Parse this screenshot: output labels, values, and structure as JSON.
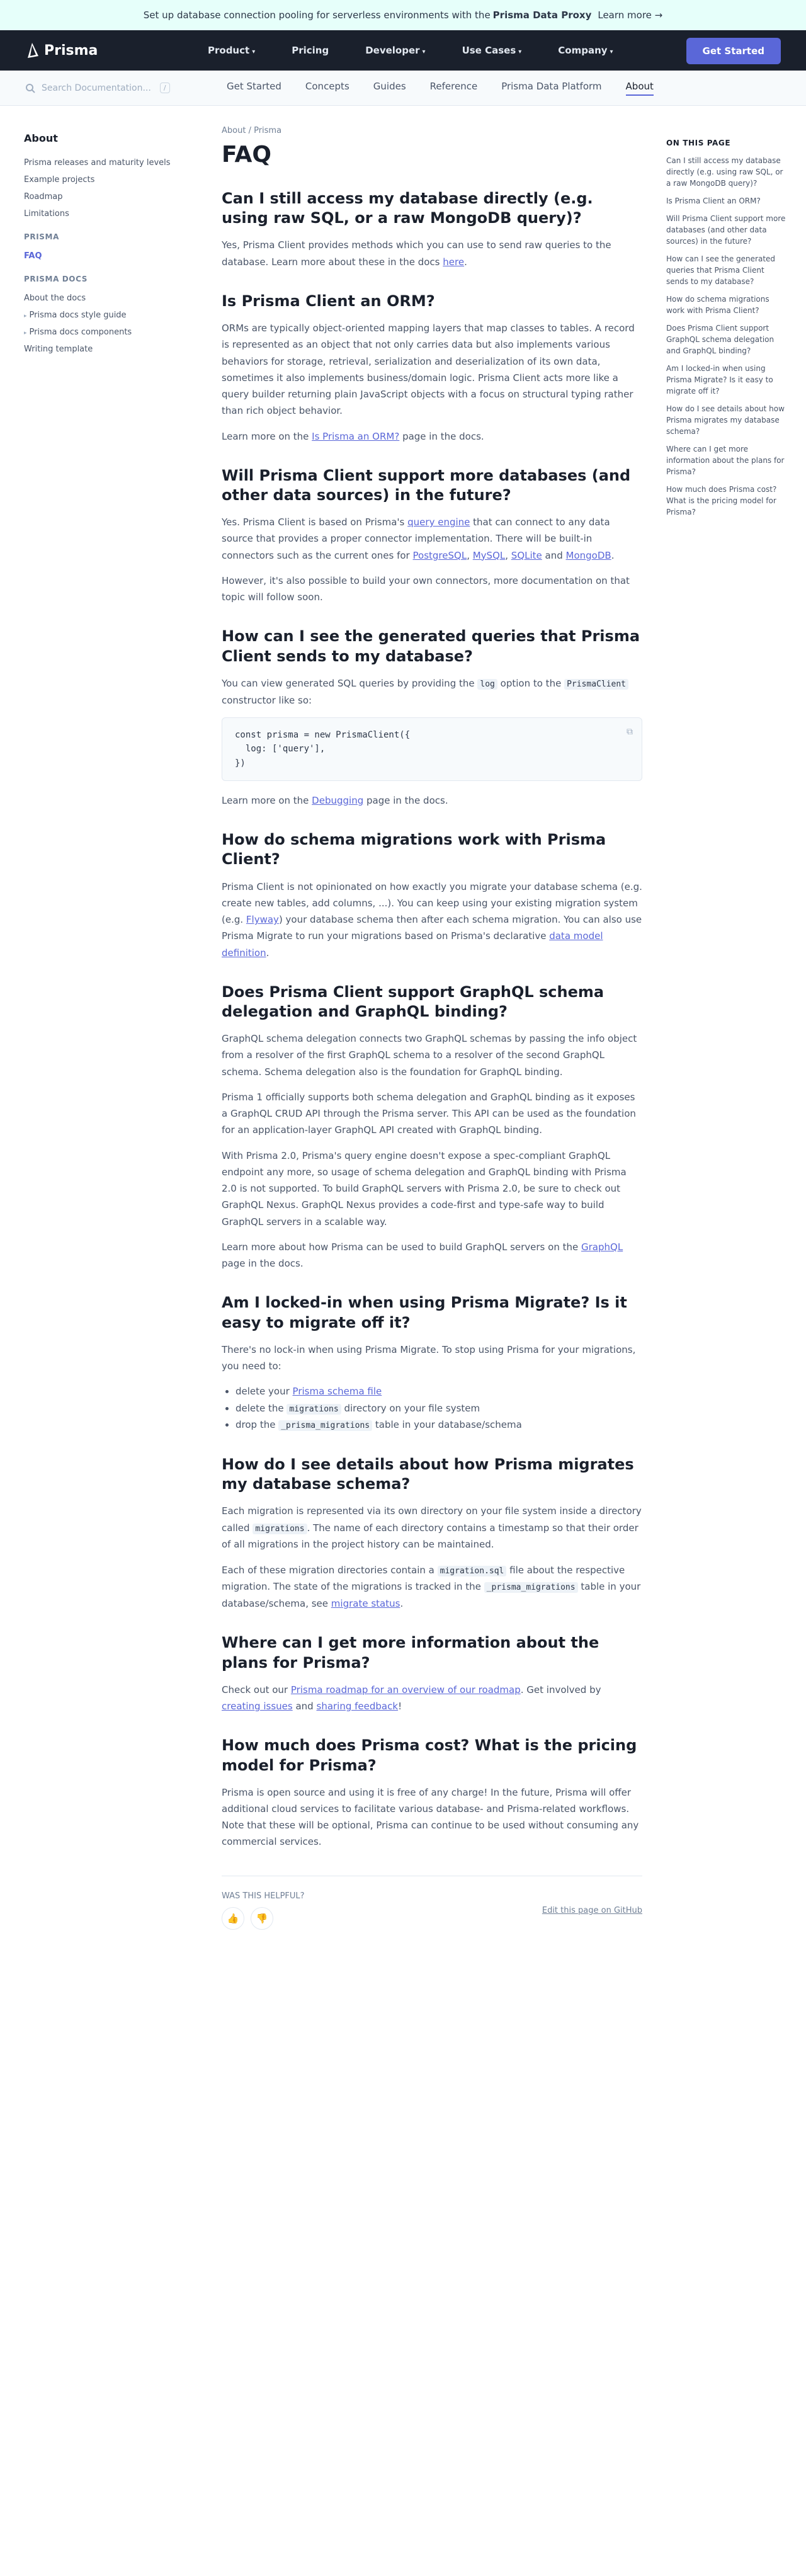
{
  "banner": {
    "text": "Set up database connection pooling for serverless environments with the",
    "bold": "Prisma Data Proxy",
    "link": "Learn more →"
  },
  "topnav": {
    "logo": "Prisma",
    "items": [
      {
        "label": "Product",
        "chevron": true
      },
      {
        "label": "Pricing",
        "chevron": false
      },
      {
        "label": "Developer",
        "chevron": true
      },
      {
        "label": "Use Cases",
        "chevron": true
      },
      {
        "label": "Company",
        "chevron": true
      }
    ],
    "cta": "Get Started"
  },
  "subnav": {
    "search_placeholder": "Search Documentation...",
    "kbd": "/",
    "tabs": [
      "Get Started",
      "Concepts",
      "Guides",
      "Reference",
      "Prisma Data Platform",
      "About"
    ],
    "active_tab": "About"
  },
  "leftnav": {
    "title": "About",
    "sections": [
      {
        "heading": "",
        "items": [
          {
            "label": "Prisma releases and maturity levels",
            "arrow": false,
            "active": false
          },
          {
            "label": "Example projects",
            "arrow": false,
            "active": false
          },
          {
            "label": "Roadmap",
            "arrow": false,
            "active": false
          },
          {
            "label": "Limitations",
            "arrow": false,
            "active": false
          }
        ]
      },
      {
        "heading": "PRISMA",
        "items": [
          {
            "label": "FAQ",
            "arrow": false,
            "active": true
          }
        ]
      },
      {
        "heading": "PRISMA DOCS",
        "items": [
          {
            "label": "About the docs",
            "arrow": false,
            "active": false
          },
          {
            "label": "Prisma docs style guide",
            "arrow": true,
            "active": false
          },
          {
            "label": "Prisma docs components",
            "arrow": true,
            "active": false
          },
          {
            "label": "Writing template",
            "arrow": false,
            "active": false
          }
        ]
      }
    ]
  },
  "content": {
    "breadcrumb": "About / Prisma",
    "title": "FAQ",
    "q1": {
      "heading": "Can I still access my database directly (e.g. using raw SQL, or a raw MongoDB query)?",
      "p": "Yes, Prisma Client provides methods which you can use to send raw queries to the database. Learn more about these in the docs",
      "link": "here",
      "end": "."
    },
    "q2": {
      "heading": "Is Prisma Client an ORM?",
      "p1": "ORMs are typically object-oriented mapping layers that map classes to tables. A record is represented as an object that not only carries data but also implements various behaviors for storage, retrieval, serialization and deserialization of its own data, sometimes it also implements business/domain logic. Prisma Client acts more like a query builder returning plain JavaScript objects with a focus on structural typing rather than rich object behavior.",
      "p2a": "Learn more on the",
      "link": "Is Prisma an ORM?",
      "p2b": "page in the docs."
    },
    "q3": {
      "heading": "Will Prisma Client support more databases (and other data sources) in the future?",
      "p1a": "Yes. Prisma Client is based on Prisma's",
      "link1": "query engine",
      "p1b": "that can connect to any data source that provides a proper connector implementation. There will be built-in connectors such as the current ones for",
      "link2": "PostgreSQL",
      "link3": "MySQL",
      "link4": "SQLite",
      "link5": "MongoDB",
      "p2": "However, it's also possible to build your own connectors, more documentation on that topic will follow soon."
    },
    "q4": {
      "heading": "How can I see the generated queries that Prisma Client sends to my database?",
      "p1a": "You can view generated SQL queries by providing the",
      "code1": "log",
      "p1b": "option to the",
      "code2": "PrismaClient",
      "p1c": "constructor like so:",
      "code_lines": [
        "const prisma = new PrismaClient({",
        "  log: ['query'],",
        "})"
      ],
      "copy_icon": "copy-icon",
      "p2a": "Learn more on the",
      "link": "Debugging",
      "p2b": "page in the docs."
    },
    "q5": {
      "heading": "How do schema migrations work with Prisma Client?",
      "p": "Prisma Client is not opinionated on how exactly you migrate your database schema (e.g. create new tables, add columns, ...). You can keep using your existing migration system (e.g.",
      "link1": "Flyway",
      "p_mid": ") your database schema then after each schema migration. You can also use Prisma Migrate to run your migrations based on Prisma's declarative",
      "link2": "data model definition",
      "p_end": "."
    },
    "q6": {
      "heading": "Does Prisma Client support GraphQL schema delegation and GraphQL binding?",
      "p1": "GraphQL schema delegation connects two GraphQL schemas by passing the info object from a resolver of the first GraphQL schema to a resolver of the second GraphQL schema. Schema delegation also is the foundation for GraphQL binding.",
      "p2": "Prisma 1 officially supports both schema delegation and GraphQL binding as it exposes a GraphQL CRUD API through the Prisma server. This API can be used as the foundation for an application-layer GraphQL API created with GraphQL binding.",
      "p3": "With Prisma 2.0, Prisma's query engine doesn't expose a spec-compliant GraphQL endpoint any more, so usage of schema delegation and GraphQL binding with Prisma 2.0 is not supported. To build GraphQL servers with Prisma 2.0, be sure to check out GraphQL Nexus. GraphQL Nexus provides a code-first and type-safe way to build GraphQL servers in a scalable way.",
      "p4a": "Learn more about how Prisma can be used to build GraphQL servers on the",
      "link": "GraphQL",
      "p4b": "page in the docs."
    },
    "q7": {
      "heading": "Am I locked-in when using Prisma Migrate? Is it easy to migrate off it?",
      "p": "There's no lock-in when using Prisma Migrate. To stop using Prisma for your migrations, you need to:",
      "li1a": "delete your",
      "li1link": "Prisma schema file",
      "li2a": "delete the",
      "li2code": "migrations",
      "li2b": "directory on your file system",
      "li3a": "drop the",
      "li3code": "_prisma_migrations",
      "li3b": "table in your database/schema"
    },
    "q8": {
      "heading": "How do I see details about how Prisma migrates my database schema?",
      "p1a": "Each migration is represented via its own directory on your file system inside a directory called",
      "code1": "migrations",
      "p1b": ". The name of each directory contains a timestamp so that their order of all migrations in the project history can be maintained.",
      "p2a": "Each of these migration directories contain a",
      "code2": "migration.sql",
      "p2b": "file about the respective migration. The state of the migrations is tracked in the",
      "code3": "_prisma_migrations",
      "p2c": "table in your database/schema, see",
      "link": "migrate status",
      "p2d": "."
    },
    "q9": {
      "heading": "Where can I get more information about the plans for Prisma?",
      "pa": "Check out our",
      "link1": "Prisma roadmap for an overview of our roadmap",
      "pb": ". Get involved by",
      "link2": "creating issues",
      "pc": "and",
      "link3": "sharing feedback",
      "pd": "!"
    },
    "q10": {
      "heading": "How much does Prisma cost? What is the pricing model for Prisma?",
      "p": "Prisma is open source and using it is free of any charge! In the future, Prisma will offer additional cloud services to facilitate various database- and Prisma-related workflows. Note that these will be optional, Prisma can continue to be used without consuming any commercial services."
    },
    "footer": {
      "helpful": "WAS THIS HELPFUL?",
      "thumbs_up": "👍",
      "thumbs_down": "👎",
      "edit": "Edit this page on GitHub"
    }
  },
  "toc": {
    "heading": "ON THIS PAGE",
    "items": [
      "Can I still access my database directly (e.g. using raw SQL, or a raw MongoDB query)?",
      "Is Prisma Client an ORM?",
      "Will Prisma Client support more databases (and other data sources) in the future?",
      "How can I see the generated queries that Prisma Client sends to my database?",
      "How do schema migrations work with Prisma Client?",
      "Does Prisma Client support GraphQL schema delegation and GraphQL binding?",
      "Am I locked-in when using Prisma Migrate? Is it easy to migrate off it?",
      "How do I see details about how Prisma migrates my database schema?",
      "Where can I get more information about the plans for Prisma?",
      "How much does Prisma cost? What is the pricing model for Prisma?"
    ]
  }
}
